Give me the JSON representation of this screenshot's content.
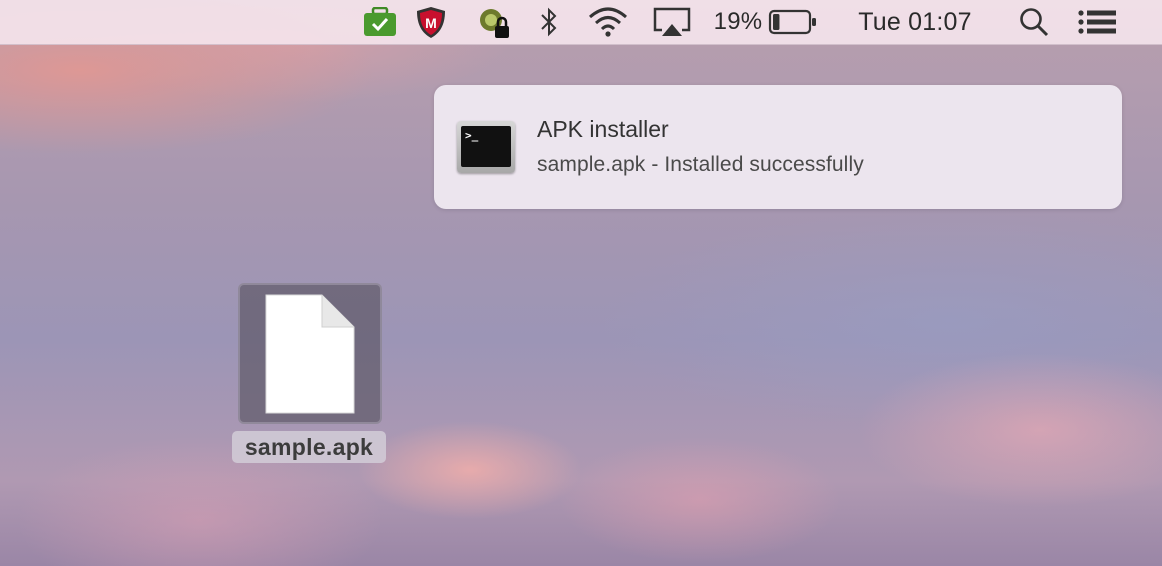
{
  "menubar": {
    "battery_percent": "19%",
    "battery_level": 0.19,
    "clock": "Tue 01:07",
    "icons": [
      "work-bag-check-icon",
      "mcafee-shield-icon",
      "vpn-lock-icon",
      "bluetooth-icon",
      "wifi-icon",
      "airplay-icon",
      "battery-icon",
      "spotlight-search-icon",
      "notification-center-icon"
    ],
    "mcafee_letter": "M"
  },
  "notification": {
    "title": "APK installer",
    "message": "sample.apk - Installed successfully",
    "icon": "terminal-icon",
    "icon_prompt": ">_"
  },
  "desktop": {
    "file_name": "sample.apk",
    "file_icon": "document-icon"
  },
  "colors": {
    "bag_green": "#4a9a2e",
    "mcafee_red": "#c8102e",
    "menubar_bg": "#f4e4ec"
  }
}
